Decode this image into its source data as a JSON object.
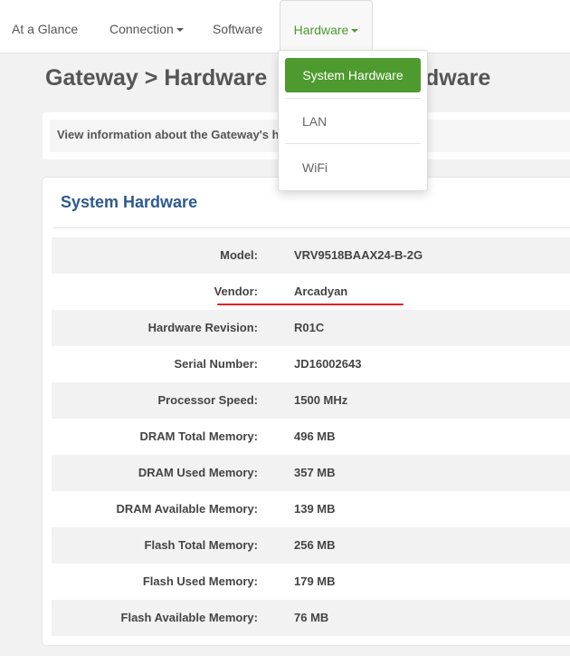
{
  "nav": {
    "items": [
      {
        "label": "At a Glance",
        "has_dropdown": false
      },
      {
        "label": "Connection",
        "has_dropdown": true
      },
      {
        "label": "Software",
        "has_dropdown": false
      },
      {
        "label": "Hardware",
        "has_dropdown": true,
        "active": true
      }
    ]
  },
  "page": {
    "title": "Gateway > Hardware",
    "title_tail": "dware",
    "description": "View information about the Gateway's ha"
  },
  "dropdown": {
    "items": [
      {
        "label": "System Hardware",
        "active": true
      },
      {
        "label": "LAN",
        "active": false
      },
      {
        "label": "WiFi",
        "active": false
      }
    ]
  },
  "card": {
    "title": "System Hardware",
    "rows": [
      {
        "label": "Model:",
        "value": "VRV9518BAAX24-B-2G"
      },
      {
        "label": "Vendor:",
        "value": "Arcadyan",
        "highlighted": true
      },
      {
        "label": "Hardware Revision:",
        "value": "R01C"
      },
      {
        "label": "Serial Number:",
        "value": "JD16002643"
      },
      {
        "label": "Processor Speed:",
        "value": "1500 MHz"
      },
      {
        "label": "DRAM Total Memory:",
        "value": "496 MB"
      },
      {
        "label": "DRAM Used Memory:",
        "value": "357 MB"
      },
      {
        "label": "DRAM Available Memory:",
        "value": "139 MB"
      },
      {
        "label": "Flash Total Memory:",
        "value": "256 MB"
      },
      {
        "label": "Flash Used Memory:",
        "value": "179 MB"
      },
      {
        "label": "Flash Available Memory:",
        "value": "76 MB"
      }
    ]
  },
  "colors": {
    "accent_green": "#4e9a2e",
    "card_title_blue": "#2e5a8e",
    "highlight_red": "#d9232a"
  }
}
